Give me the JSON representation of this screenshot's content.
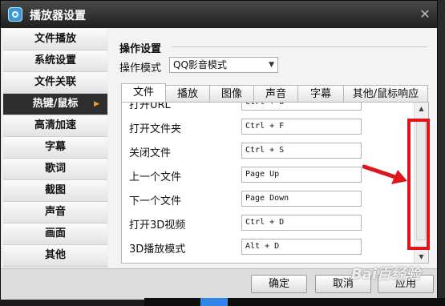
{
  "window": {
    "title": "播放器设置"
  },
  "sidebar": {
    "items": [
      {
        "label": "文件播放"
      },
      {
        "label": "系统设置"
      },
      {
        "label": "文件关联"
      },
      {
        "label": "热键/鼠标"
      },
      {
        "label": "高清加速"
      },
      {
        "label": "字幕"
      },
      {
        "label": "歌词"
      },
      {
        "label": "截图"
      },
      {
        "label": "声音"
      },
      {
        "label": "画面"
      },
      {
        "label": "其他"
      }
    ],
    "active_index": 3
  },
  "main": {
    "section_title": "操作设置",
    "mode_label": "操作模式",
    "mode_value": "QQ影音模式",
    "tabs": [
      {
        "label": "文件"
      },
      {
        "label": "播放"
      },
      {
        "label": "图像"
      },
      {
        "label": "声音"
      },
      {
        "label": "字幕"
      },
      {
        "label": "其他/鼠标响应"
      }
    ],
    "active_tab": 0,
    "hotkeys": [
      {
        "label": "打开URL",
        "key": "Ctrl + U"
      },
      {
        "label": "打开文件夹",
        "key": "Ctrl + F"
      },
      {
        "label": "关闭文件",
        "key": "Ctrl + S"
      },
      {
        "label": "上一个文件",
        "key": "Page Up"
      },
      {
        "label": "下一个文件",
        "key": "Page Down"
      },
      {
        "label": "打开3D视频",
        "key": "Ctrl + D"
      },
      {
        "label": "3D播放模式",
        "key": "Alt + D"
      }
    ]
  },
  "footer": {
    "ok_label": "确定",
    "cancel_label": "取消",
    "apply_label": "应用"
  },
  "watermark": "Bai百经验",
  "colors": {
    "highlight": "#e0141a",
    "active_sidebar": "#2e2e2e",
    "accent_arrow": "#f0a030"
  }
}
